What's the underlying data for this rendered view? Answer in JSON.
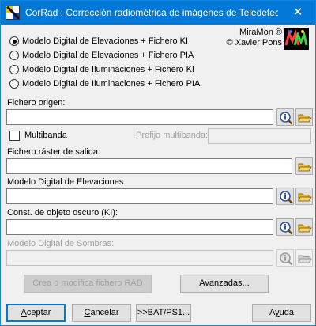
{
  "window": {
    "title": "CorRad : Corrección radiométrica de imágenes de Teledetecci...",
    "close_glyph": "✕"
  },
  "brand": {
    "line1": "MiraMon ®",
    "line2": "© Xavier Pons"
  },
  "model_options": [
    {
      "label": "Modelo Digital de Elevaciones + Fichero KI",
      "selected": true
    },
    {
      "label": "Modelo Digital de Elevaciones + Fichero PIA",
      "selected": false
    },
    {
      "label": "Modelo Digital de Iluminaciones + Fichero KI",
      "selected": false
    },
    {
      "label": "Modelo Digital de Iluminaciones + Fichero PIA",
      "selected": false
    }
  ],
  "fields": {
    "source_label": "Fichero origen:",
    "source_value": "",
    "multiband_label": "Multibanda",
    "multiband_checked": false,
    "multiband_prefix_label": "Prefijo multibanda:",
    "multiband_prefix_value": "",
    "output_label": "Fichero ráster de salida:",
    "output_value": "",
    "dem_label": "Modelo Digital de Elevaciones:",
    "dem_value": "",
    "dark_object_label": "Const. de objeto oscuro (KI):",
    "dark_object_value": "",
    "shadow_label": "Modelo Digital de Sombras:",
    "shadow_value": ""
  },
  "buttons": {
    "create_rad": "Crea o modifica fichero RAD",
    "advanced": "Avanzadas...",
    "accept": "Aceptar",
    "cancel": "Cancelar",
    "bat": ">>BAT/PS1...",
    "help": "Ayuda"
  },
  "colors": {
    "titlebar": "#0078d7",
    "dialog_bg": "#f0f0f0",
    "button_face": "#e1e1e1",
    "disabled_text": "#a0a0a0"
  }
}
